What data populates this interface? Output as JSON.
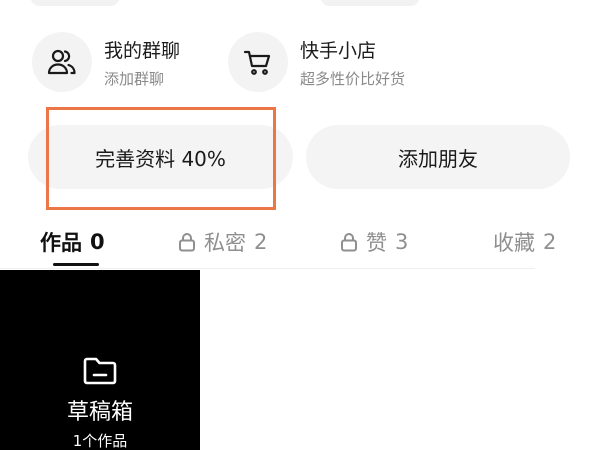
{
  "shortcuts": [
    {
      "title": "我的群聊",
      "subtitle": "添加群聊",
      "icon": "group-chat-icon"
    },
    {
      "title": "快手小店",
      "subtitle": "超多性价比好货",
      "icon": "shopping-cart-icon"
    }
  ],
  "actions": {
    "complete_profile": "完善资料 40%",
    "add_friend": "添加朋友"
  },
  "profile_completion": 40,
  "highlight_color": "#ec7645",
  "tabs": [
    {
      "label": "作品",
      "count": "0",
      "locked": false,
      "active": true
    },
    {
      "label": "私密",
      "count": "2",
      "locked": true,
      "active": false
    },
    {
      "label": "赞",
      "count": "3",
      "locked": true,
      "active": false
    },
    {
      "label": "收藏",
      "count": "2",
      "locked": false,
      "active": false
    }
  ],
  "draft": {
    "title": "草稿箱",
    "count_label": "1个作品",
    "icon": "folder-icon"
  }
}
